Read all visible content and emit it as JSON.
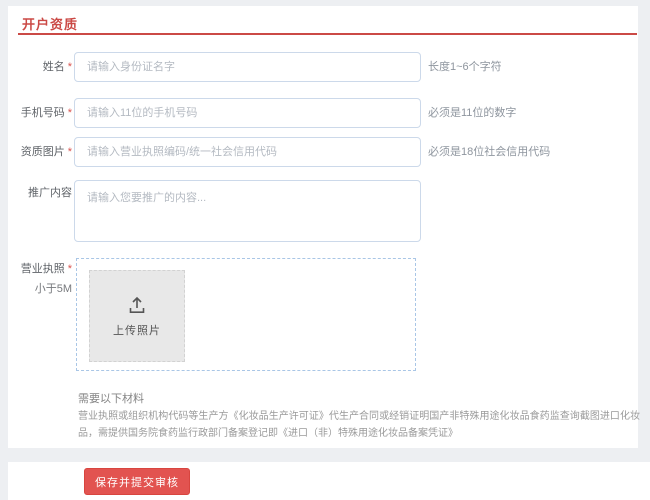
{
  "page": {
    "title": "开户资质"
  },
  "ui": {
    "required_mark": "*"
  },
  "form": {
    "fields": [
      {
        "label": "姓名",
        "required": true,
        "placeholder": "请输入身份证名字",
        "hint": "长度1~6个字符"
      },
      {
        "label": "手机号码",
        "required": true,
        "placeholder": "请输入11位的手机号码",
        "hint": "必须是11位的数字"
      },
      {
        "label": "资质图片",
        "required": true,
        "placeholder": "请输入营业执照编码/统一社会信用代码",
        "hint": "必须是18位社会信用代码"
      },
      {
        "label": "推广内容",
        "required": false,
        "placeholder": "请输入您要推广的内容..."
      }
    ],
    "upload": {
      "label": "营业执照",
      "required": true,
      "size_limit": "小于5M",
      "button_text": "上传照片"
    },
    "note": {
      "title": "需要以下材料",
      "body": "营业执照或组织机构代码等生产方《化妆品生产许可证》代生产合同或经销证明国产非特殊用途化妆品食药监查询截图进口化妆品，需提供国务院食药监行政部门备案登记即《进口（非）特殊用途化妆品备案凭证》"
    },
    "submit_label": "保存并提交审核"
  },
  "colors": {
    "accent_red": "#cb4a46",
    "button_red": "#e25350",
    "input_border": "#ccd9ea",
    "upload_border": "#a9c6e6",
    "upload_box_bg": "#e8e8e8",
    "page_background": "#edeff2"
  }
}
